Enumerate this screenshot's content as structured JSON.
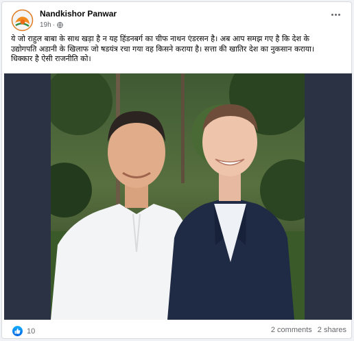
{
  "post": {
    "author": "Nandkishor Panwar",
    "time": "19h",
    "separator": "·",
    "audience_icon": "globe-icon",
    "text_lines": [
      "ये जो राहुल बाबा के साथ खड़ा है न यह हिंडनबर्ग का चीफ नाथन एंडरसन है। अब आप समझ गए है कि देश के",
      "उद्योगपति अडानी के खिलाफ जो षडयंत्र रचा गया वह किसने कराया है। सत्ता की खातिर देश का नुकसान कराया।",
      "धिक्कार है ऐसी राजनीति को।"
    ]
  },
  "engagement": {
    "reaction_icon": "like-icon",
    "reaction_count": "10",
    "comments": "2 comments",
    "shares": "2 shares"
  },
  "colors": {
    "accent": "#1877f2",
    "secondary_text": "#65676b",
    "media_background": "#2a3243"
  }
}
